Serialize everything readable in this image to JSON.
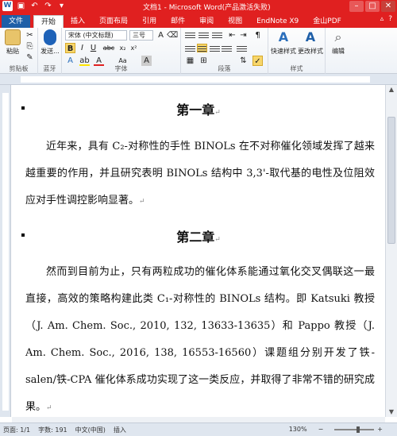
{
  "titlebar": {
    "title": "文档1 - Microsoft Word(产品激活失败)",
    "qat": [
      "W",
      "↶",
      "↷",
      "▾"
    ],
    "min": "–",
    "max": "□",
    "close": "✕"
  },
  "tabs": {
    "file": "文件",
    "items": [
      "开始",
      "插入",
      "页面布局",
      "引用",
      "邮件",
      "审阅",
      "视图",
      "EndNote X9",
      "金山PDF"
    ],
    "right": [
      "▵",
      "?"
    ]
  },
  "ribbon": {
    "clipboard": {
      "paste": "粘贴",
      "label": "剪贴板"
    },
    "bluetooth": {
      "send": "发送...",
      "label": "蓝牙"
    },
    "font": {
      "name": "宋体 (中文标题)",
      "size": "三号",
      "label": "字体",
      "buttons": [
        "B",
        "I",
        "U",
        "abc",
        "x₂",
        "x²",
        "A",
        "Aa",
        "A",
        "A"
      ]
    },
    "paragraph": {
      "label": "段落"
    },
    "styles": {
      "quick": "快速样式",
      "change": "更改样式",
      "label": "样式"
    },
    "editing": {
      "label": "编辑"
    }
  },
  "document": {
    "heading1": "第一章",
    "para1": "近年来，具有 C₂-对称性的手性 BINOLs 在不对称催化领域发挥了越来越重要的作用，并且研究表明 BINOLs 结构中 3,3'-取代基的电性及位阻效应对手性调控影响显著。",
    "heading2": "第二章",
    "para2": "然而到目前为止，只有两粒成功的催化体系能通过氧化交叉偶联这一最直接，高效的策略构建此类 C₁-对称性的 BINOLs 结构。即 Katsuki 教授（J. Am. Chem. Soc., 2010, 132, 13633-13635）和 Pappo 教授（J. Am. Chem. Soc., 2016, 138, 16553-16560）课题组分别开发了铁-salen/铁-CPA 催化体系成功实现了这一类反应，并取得了非常不错的研究成果。",
    "mark": "↵"
  },
  "statusbar": {
    "page": "页面: 1/1",
    "words": "字数: 191",
    "lang": "中文(中国)",
    "mode": "插入",
    "zoom": "130%",
    "zoom_level": 0.6
  }
}
